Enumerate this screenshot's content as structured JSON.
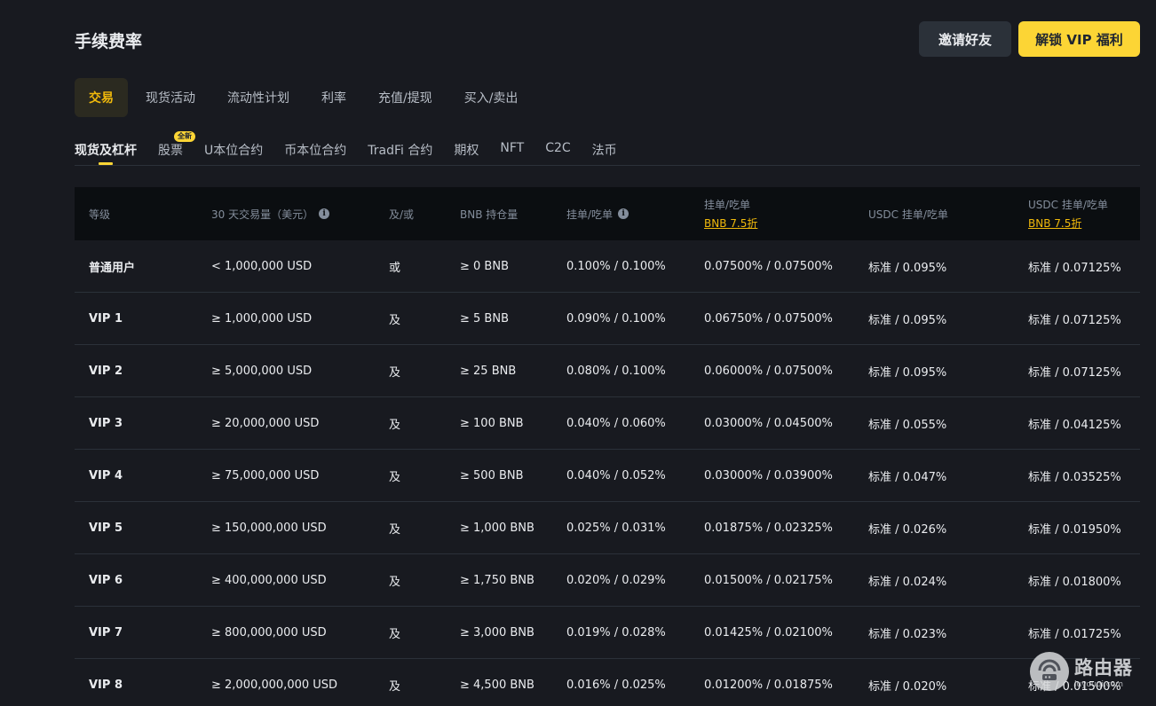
{
  "header": {
    "title": "手续费率",
    "invite_button": "邀请好友",
    "vip_button": "解锁 VIP 福利"
  },
  "category_tabs": [
    {
      "label": "交易",
      "active": true
    },
    {
      "label": "现货活动",
      "active": false
    },
    {
      "label": "流动性计划",
      "active": false
    },
    {
      "label": "利率",
      "active": false
    },
    {
      "label": "充值/提现",
      "active": false
    },
    {
      "label": "买入/卖出",
      "active": false
    }
  ],
  "sub_tabs": [
    {
      "label": "现货及杠杆",
      "active": true
    },
    {
      "label": "股票",
      "badge": "全新"
    },
    {
      "label": "U本位合约"
    },
    {
      "label": "币本位合约"
    },
    {
      "label": "TradFi 合约"
    },
    {
      "label": "期权"
    },
    {
      "label": "NFT"
    },
    {
      "label": "C2C"
    },
    {
      "label": "法币"
    }
  ],
  "table": {
    "headers": {
      "level": "等级",
      "volume": "30 天交易量（美元）",
      "and_or": "及/或",
      "bnb": "BNB 持仓量",
      "maker_taker": "挂单/吃单",
      "maker_taker_bnb": "挂单/吃单",
      "bnb_discount": "BNB 7.5折",
      "usdc": "USDC 挂单/吃单",
      "usdc_bnb": "USDC 挂单/吃单",
      "usdc_bnb_discount": "BNB 7.5折"
    },
    "rows": [
      {
        "level": "普通用户",
        "volume": "< 1,000,000 USD",
        "and_or": "或",
        "bnb": "≥ 0 BNB",
        "fee": "0.100% / 0.100%",
        "fee_bnb": "0.07500% / 0.07500%",
        "usdc": "标准 / 0.095%",
        "usdc_bnb": "标准 / 0.07125%"
      },
      {
        "level": "VIP 1",
        "volume": "≥ 1,000,000 USD",
        "and_or": "及",
        "bnb": "≥ 5 BNB",
        "fee": "0.090% / 0.100%",
        "fee_bnb": "0.06750% / 0.07500%",
        "usdc": "标准 / 0.095%",
        "usdc_bnb": "标准 / 0.07125%"
      },
      {
        "level": "VIP 2",
        "volume": "≥ 5,000,000 USD",
        "and_or": "及",
        "bnb": "≥ 25 BNB",
        "fee": "0.080% / 0.100%",
        "fee_bnb": "0.06000% / 0.07500%",
        "usdc": "标准 / 0.095%",
        "usdc_bnb": "标准 / 0.07125%"
      },
      {
        "level": "VIP 3",
        "volume": "≥ 20,000,000 USD",
        "and_or": "及",
        "bnb": "≥ 100 BNB",
        "fee": "0.040% / 0.060%",
        "fee_bnb": "0.03000% / 0.04500%",
        "usdc": "标准 / 0.055%",
        "usdc_bnb": "标准 / 0.04125%"
      },
      {
        "level": "VIP 4",
        "volume": "≥ 75,000,000 USD",
        "and_or": "及",
        "bnb": "≥ 500 BNB",
        "fee": "0.040% / 0.052%",
        "fee_bnb": "0.03000% / 0.03900%",
        "usdc": "标准 / 0.047%",
        "usdc_bnb": "标准 / 0.03525%"
      },
      {
        "level": "VIP 5",
        "volume": "≥ 150,000,000 USD",
        "and_or": "及",
        "bnb": "≥ 1,000 BNB",
        "fee": "0.025% / 0.031%",
        "fee_bnb": "0.01875% / 0.02325%",
        "usdc": "标准 / 0.026%",
        "usdc_bnb": "标准 / 0.01950%"
      },
      {
        "level": "VIP 6",
        "volume": "≥ 400,000,000 USD",
        "and_or": "及",
        "bnb": "≥ 1,750 BNB",
        "fee": "0.020% / 0.029%",
        "fee_bnb": "0.01500% / 0.02175%",
        "usdc": "标准 / 0.024%",
        "usdc_bnb": "标准 / 0.01800%"
      },
      {
        "level": "VIP 7",
        "volume": "≥ 800,000,000 USD",
        "and_or": "及",
        "bnb": "≥ 3,000 BNB",
        "fee": "0.019% / 0.028%",
        "fee_bnb": "0.01425% / 0.02100%",
        "usdc": "标准 / 0.023%",
        "usdc_bnb": "标准 / 0.01725%"
      },
      {
        "level": "VIP 8",
        "volume": "≥ 2,000,000,000 USD",
        "and_or": "及",
        "bnb": "≥ 4,500 BNB",
        "fee": "0.016% / 0.025%",
        "fee_bnb": "0.01200% / 0.01875%",
        "usdc": "标准 / 0.020%",
        "usdc_bnb": "标准 / 0.01500%"
      }
    ]
  },
  "watermark": {
    "text": "路由器",
    "url": "luyouqi.com"
  },
  "colors": {
    "background": "#181a20",
    "accent_yellow": "#fcd535",
    "link_yellow": "#f0b90b",
    "header_row": "#0b0e11"
  }
}
